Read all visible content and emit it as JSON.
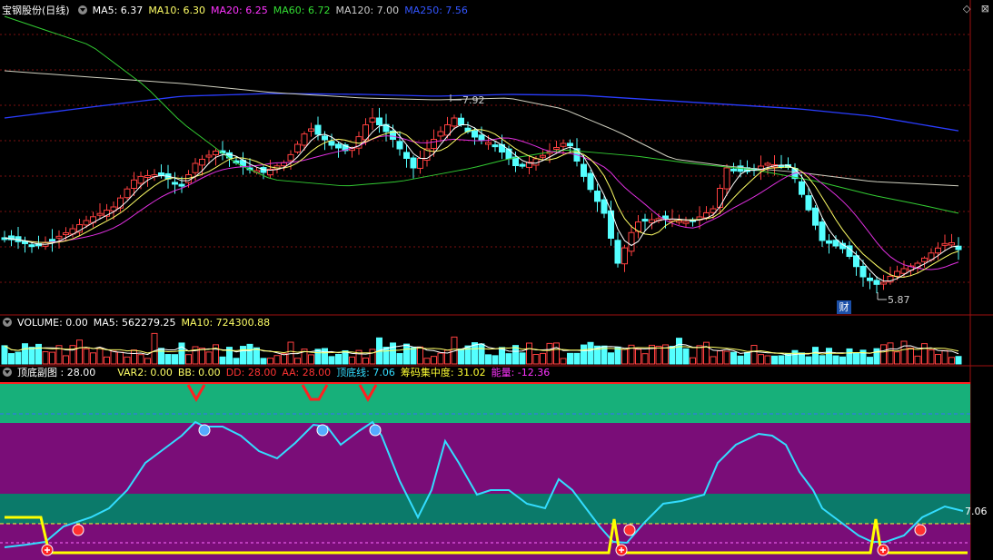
{
  "main_panel": {
    "title": "宝钢股份(日线)",
    "indicators": [
      {
        "label": "MA5: 6.37",
        "color": "#ffffff"
      },
      {
        "label": "MA10: 6.30",
        "color": "#ffff66"
      },
      {
        "label": "MA20: 6.25",
        "color": "#ff33ff"
      },
      {
        "label": "MA60: 6.72",
        "color": "#33dd33"
      },
      {
        "label": "MA120: 7.00",
        "color": "#cccccc"
      },
      {
        "label": "MA250: 7.56",
        "color": "#3355ff"
      }
    ],
    "high_marker": "7.92",
    "low_marker": "5.87",
    "badge": "财"
  },
  "volume_panel": {
    "title": "VOLUME: 0.00",
    "indicators": [
      {
        "label": "MA5: 562279.25",
        "color": "#ffffff"
      },
      {
        "label": "MA10: 724300.88",
        "color": "#ffff66"
      }
    ]
  },
  "sub_panel": {
    "title": "顶底副图 : 28.00",
    "indicators": [
      {
        "label": "VAR2: 0.00",
        "color": "#ffff66"
      },
      {
        "label": "BB: 0.00",
        "color": "#ffff66"
      },
      {
        "label": "DD: 28.00",
        "color": "#ff3333"
      },
      {
        "label": "AA: 28.00",
        "color": "#ff3333"
      },
      {
        "label": "顶底线: 7.06",
        "color": "#33ddff"
      },
      {
        "label": "筹码集中度: 31.02",
        "color": "#ffff33"
      },
      {
        "label": "能量: -12.36",
        "color": "#ff33ff"
      }
    ],
    "current_value": "7.06"
  },
  "window_buttons": [
    {
      "icon": "diamond-icon",
      "glyph": "◇"
    },
    {
      "icon": "close-icon",
      "glyph": "⊠"
    }
  ]
}
